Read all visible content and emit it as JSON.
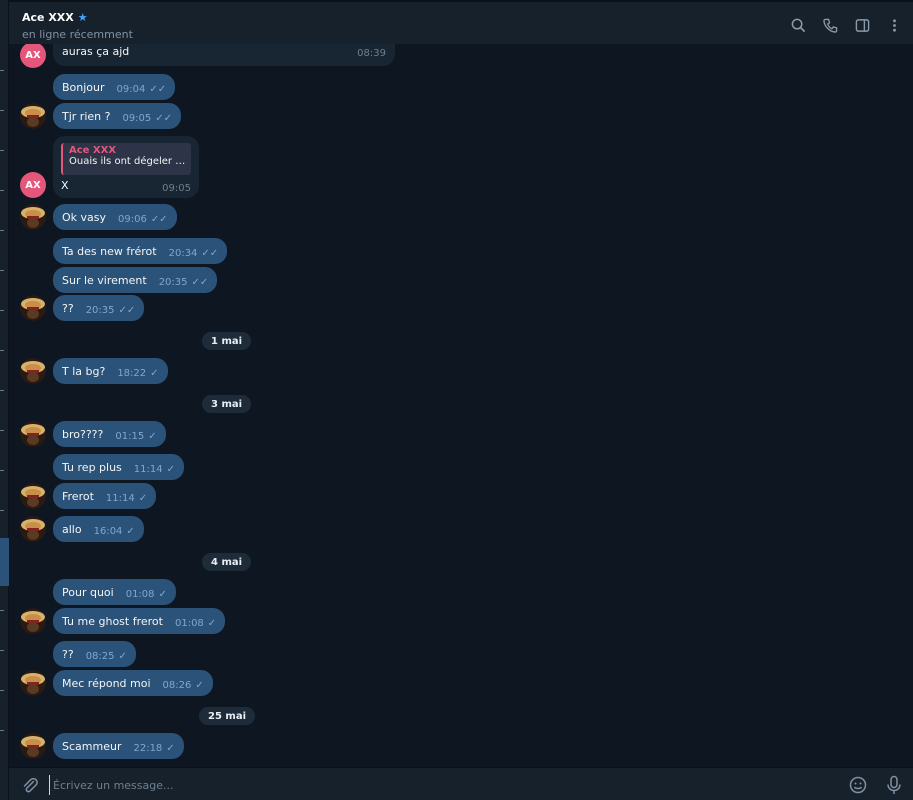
{
  "header": {
    "title": "Ace XXX",
    "star_icon": "star-icon",
    "status": "en ligne récemment",
    "icons": [
      "search-icon",
      "phone-icon",
      "sidebar-toggle-icon",
      "more-vert-icon"
    ]
  },
  "chat": {
    "contact_initials": "AX",
    "first_message": {
      "text": "auras ça ajd",
      "time": "08:39"
    },
    "messages": [
      {
        "text": "Bonjour",
        "time": "09:04"
      },
      {
        "text": "Tjr rien ?",
        "time": "09:05"
      },
      {
        "text": "Ok vasy",
        "time": "09:06"
      },
      {
        "text": "Ta des new frérot",
        "time": "20:34"
      },
      {
        "text": "Sur le virement",
        "time": "20:35"
      },
      {
        "text": "??",
        "time": "20:35"
      },
      {
        "text": "T la bg?",
        "time": "18:22"
      },
      {
        "text": "bro????",
        "time": "01:15"
      },
      {
        "text": "Tu rep plus",
        "time": "11:14"
      },
      {
        "text": "Frerot",
        "time": "11:14"
      },
      {
        "text": "allo",
        "time": "16:04"
      },
      {
        "text": "Pour quoi",
        "time": "01:08"
      },
      {
        "text": "Tu me ghost frerot",
        "time": "01:08"
      },
      {
        "text": "??",
        "time": "08:25"
      },
      {
        "text": "Mec répond moi",
        "time": "08:26"
      },
      {
        "text": "Scammeur",
        "time": "22:18"
      }
    ],
    "reply": {
      "quote_name": "Ace XXX",
      "quote_text": "Ouais ils ont dégeler m...",
      "body": "X",
      "time": "09:05"
    },
    "dates": [
      "1 mai",
      "3 mai",
      "4 mai",
      "25 mai"
    ]
  },
  "composer": {
    "placeholder": "Écrivez un message...",
    "icons": [
      "paperclip-icon",
      "emoji-icon",
      "microphone-icon"
    ]
  },
  "colors": {
    "background": "#0e1621",
    "panel": "#17212b",
    "outgoing_bubble": "#2b5278",
    "incoming_bubble": "#182533",
    "accent": "#3ea6ff",
    "contact_color": "#e5567b"
  }
}
